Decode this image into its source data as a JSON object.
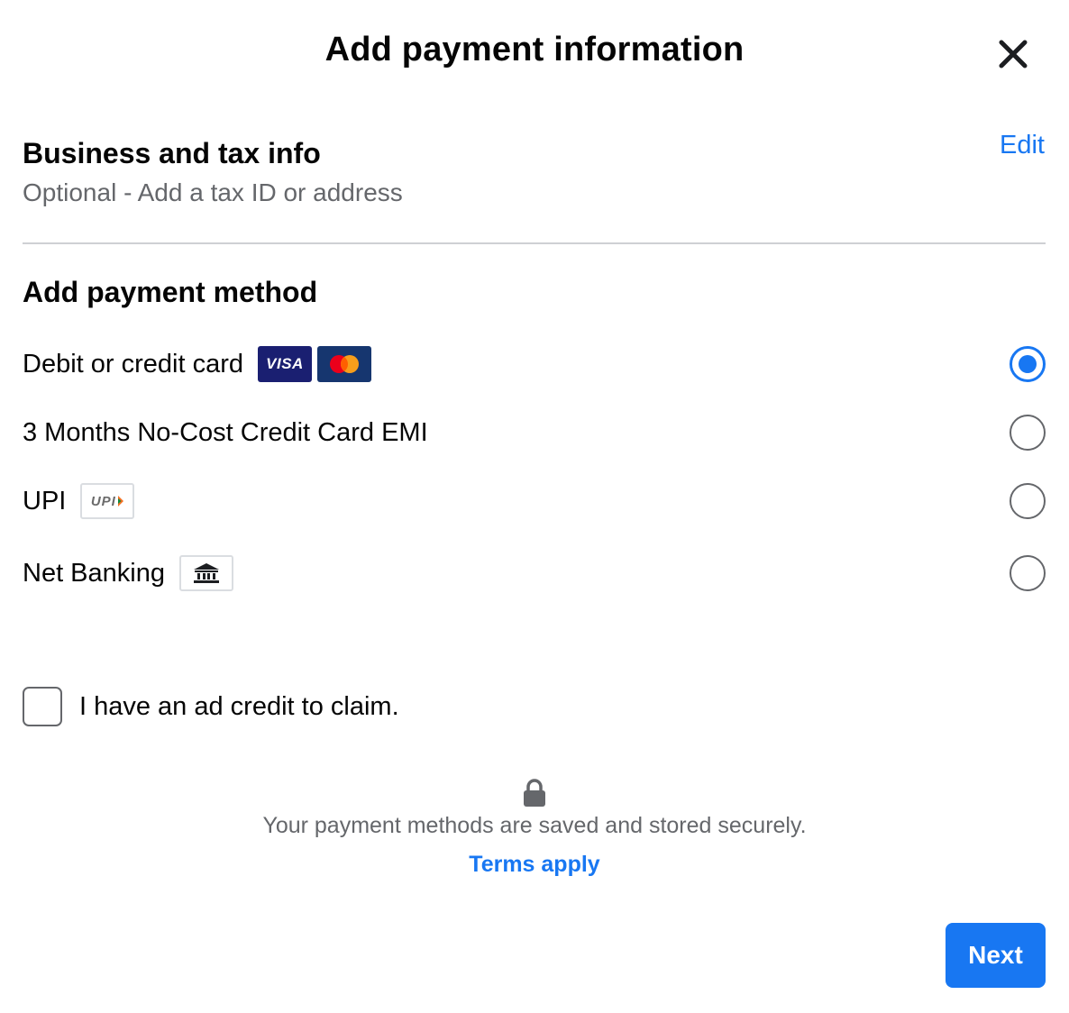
{
  "header": {
    "title": "Add payment information",
    "close_icon": "close-icon"
  },
  "business": {
    "title": "Business and tax info",
    "subtitle": "Optional - Add a tax ID or address",
    "edit_label": "Edit"
  },
  "payment": {
    "title": "Add payment method",
    "options": [
      {
        "label": "Debit or credit card",
        "selected": true,
        "icons": [
          "visa-logo",
          "mastercard-logo"
        ],
        "visa_text": "VISA"
      },
      {
        "label": "3 Months No-Cost Credit Card EMI",
        "selected": false,
        "icons": []
      },
      {
        "label": "UPI",
        "selected": false,
        "icons": [
          "upi-logo"
        ],
        "upi_text": "UPI"
      },
      {
        "label": "Net Banking",
        "selected": false,
        "icons": [
          "bank-icon"
        ]
      }
    ]
  },
  "ad_credit": {
    "label": "I have an ad credit to claim.",
    "checked": false
  },
  "security": {
    "icon": "lock-icon",
    "text": "Your payment methods are saved and stored securely.",
    "terms_label": "Terms apply"
  },
  "footer": {
    "next_label": "Next"
  },
  "colors": {
    "accent": "#1877f2",
    "secondary_text": "#65676b",
    "divider": "#ced0d4"
  }
}
